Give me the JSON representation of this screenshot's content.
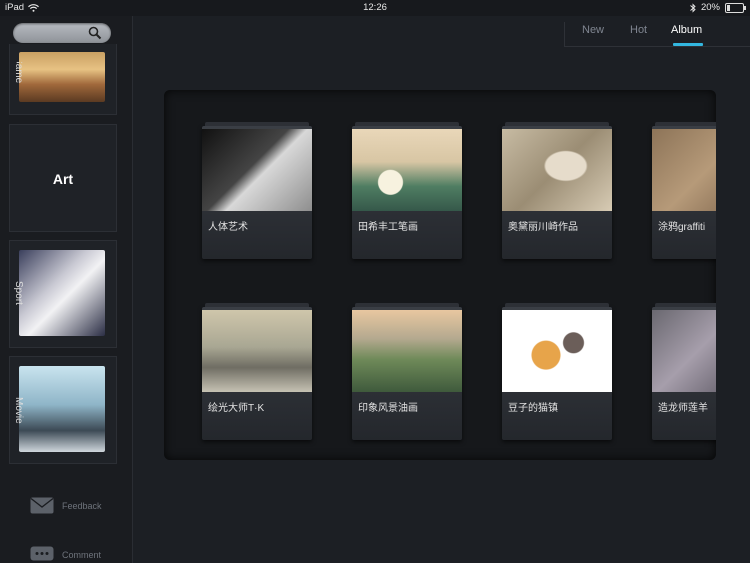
{
  "status_bar": {
    "device": "iPad",
    "time": "12:26",
    "battery": "20%"
  },
  "search": {
    "placeholder": ""
  },
  "categories": [
    {
      "label": "Game"
    },
    {
      "label": "Art"
    },
    {
      "label": "Sport"
    },
    {
      "label": "Movie"
    }
  ],
  "side_links": [
    {
      "label": "Feedback"
    },
    {
      "label": "Comment"
    }
  ],
  "tabs": [
    {
      "label": "New"
    },
    {
      "label": "Hot"
    },
    {
      "label": "Album",
      "active": true
    }
  ],
  "albums": [
    {
      "title": "人体艺术"
    },
    {
      "title": "田希丰工笔画"
    },
    {
      "title": "奥黛丽川崎作品"
    },
    {
      "title": "涂鸦graffiti"
    },
    {
      "title": "绘光大师T·K"
    },
    {
      "title": "印象风景油画"
    },
    {
      "title": "豆子的猫镇"
    },
    {
      "title": "造龙师莲羊"
    }
  ],
  "colors": {
    "accent": "#33b7e0",
    "background": "#1c1f24"
  }
}
